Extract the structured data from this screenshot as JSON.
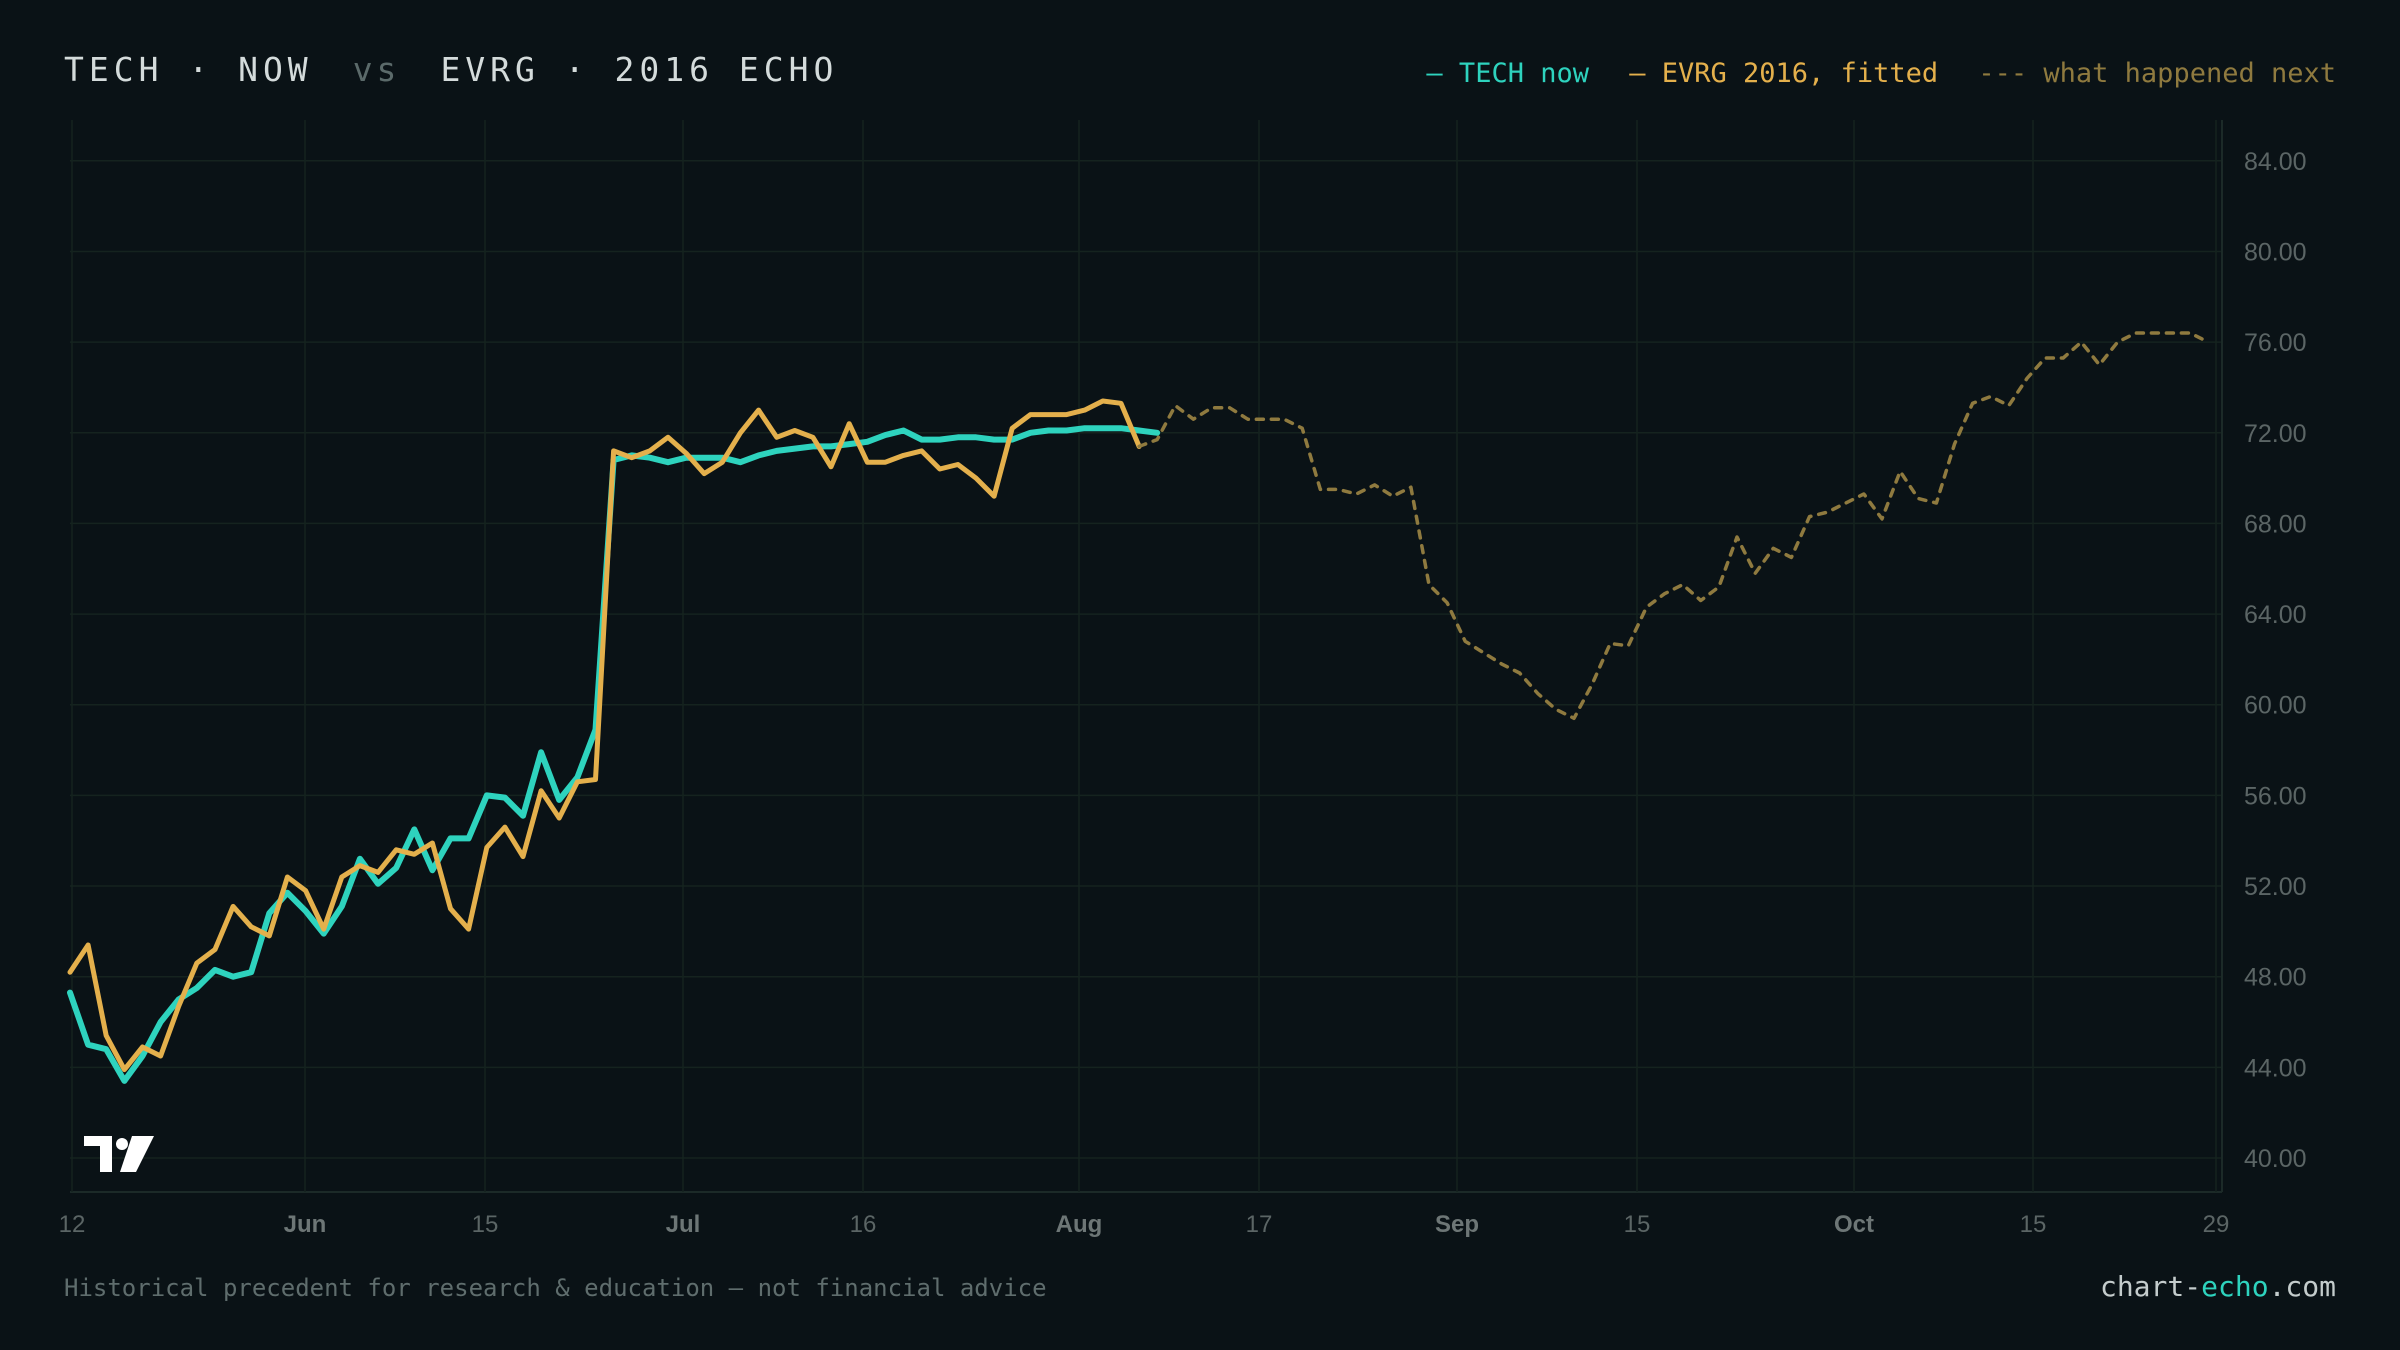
{
  "header": {
    "left_title": "TECH · NOW",
    "vs": "vs",
    "right_title": "EVRG · 2016 ECHO"
  },
  "legend": {
    "current": "— TECH now",
    "fitted": "— EVRG 2016, fitted",
    "next": "--- what happened next"
  },
  "colors": {
    "background": "#0a1216",
    "current": "#2ed3be",
    "fitted": "#e4b04c",
    "next": "#8f7a3f",
    "grid": "#15231f",
    "axis_text": "#5b6565"
  },
  "logo": {
    "icon": "tradingview-logo-icon"
  },
  "footer": {
    "disclaimer": "Historical precedent for research & education — not financial advice",
    "brand_prefix": "chart-",
    "brand_accent": "echo",
    "brand_suffix": ".com"
  },
  "chart_data": {
    "type": "line",
    "grid": true,
    "ylim": [
      38.5,
      85.8
    ],
    "y_axis_side": "right",
    "y_ticks": [
      "84.00",
      "80.00",
      "76.00",
      "72.00",
      "68.00",
      "64.00",
      "60.00",
      "56.00",
      "52.00",
      "48.00",
      "44.00",
      "40.00"
    ],
    "x_ticks": [
      {
        "label": "12",
        "bold": false
      },
      {
        "label": "Jun",
        "bold": true
      },
      {
        "label": "15",
        "bold": false
      },
      {
        "label": "Jul",
        "bold": true
      },
      {
        "label": "16",
        "bold": false
      },
      {
        "label": "Aug",
        "bold": true
      },
      {
        "label": "17",
        "bold": false
      },
      {
        "label": "Sep",
        "bold": true
      },
      {
        "label": "15",
        "bold": false
      },
      {
        "label": "Oct",
        "bold": true
      },
      {
        "label": "15",
        "bold": false
      },
      {
        "label": "29",
        "bold": false
      }
    ],
    "series": [
      {
        "name": "TECH now",
        "values": [
          47.3,
          45.0,
          44.8,
          43.4,
          44.5,
          46.0,
          47.0,
          47.5,
          48.3,
          48.0,
          48.2,
          50.8,
          51.7,
          50.9,
          49.9,
          51.1,
          53.2,
          52.1,
          52.8,
          54.5,
          52.7,
          54.1,
          54.1,
          56.0,
          55.9,
          55.1,
          57.9,
          55.8,
          56.8,
          58.9,
          70.8,
          71.0,
          70.9,
          70.7,
          70.9,
          70.9,
          70.9,
          70.7,
          71.0,
          71.2,
          71.3,
          71.4,
          71.4,
          71.5,
          71.6,
          71.9,
          72.1,
          71.7,
          71.7,
          71.8,
          71.8,
          71.7,
          71.7,
          72.0,
          72.1,
          72.1,
          72.2,
          72.2,
          72.2,
          72.1,
          72.0
        ]
      },
      {
        "name": "EVRG 2016, fitted",
        "values": [
          48.2,
          49.4,
          45.4,
          43.9,
          44.9,
          44.5,
          46.7,
          48.6,
          49.2,
          51.1,
          50.2,
          49.8,
          52.4,
          51.8,
          50.1,
          52.4,
          52.9,
          52.6,
          53.6,
          53.4,
          53.9,
          51.0,
          50.1,
          53.7,
          54.6,
          53.3,
          56.2,
          55.0,
          56.6,
          56.7,
          71.2,
          70.9,
          71.2,
          71.8,
          71.1,
          70.2,
          70.7,
          72.0,
          73.0,
          71.8,
          72.1,
          71.8,
          70.5,
          72.4,
          70.7,
          70.7,
          71.0,
          71.2,
          70.4,
          70.6,
          70.0,
          69.2,
          72.2,
          72.8,
          72.8,
          72.8,
          73.0,
          73.4,
          73.3,
          71.4
        ]
      },
      {
        "name": "what happened next",
        "values": [
          71.4,
          71.7,
          73.2,
          72.6,
          73.1,
          73.1,
          72.6,
          72.6,
          72.6,
          72.2,
          69.5,
          69.5,
          69.3,
          69.7,
          69.2,
          69.6,
          65.3,
          64.5,
          62.8,
          62.3,
          61.8,
          61.4,
          60.5,
          59.8,
          59.4,
          60.9,
          62.7,
          62.6,
          64.3,
          64.9,
          65.3,
          64.6,
          65.2,
          67.4,
          65.8,
          66.9,
          66.5,
          68.3,
          68.5,
          68.9,
          69.3,
          68.2,
          70.3,
          69.1,
          68.9,
          71.5,
          73.3,
          73.6,
          73.2,
          74.4,
          75.3,
          75.3,
          76.0,
          75.0,
          76.0,
          76.4,
          76.4,
          76.4,
          76.4,
          76.0
        ]
      }
    ]
  }
}
